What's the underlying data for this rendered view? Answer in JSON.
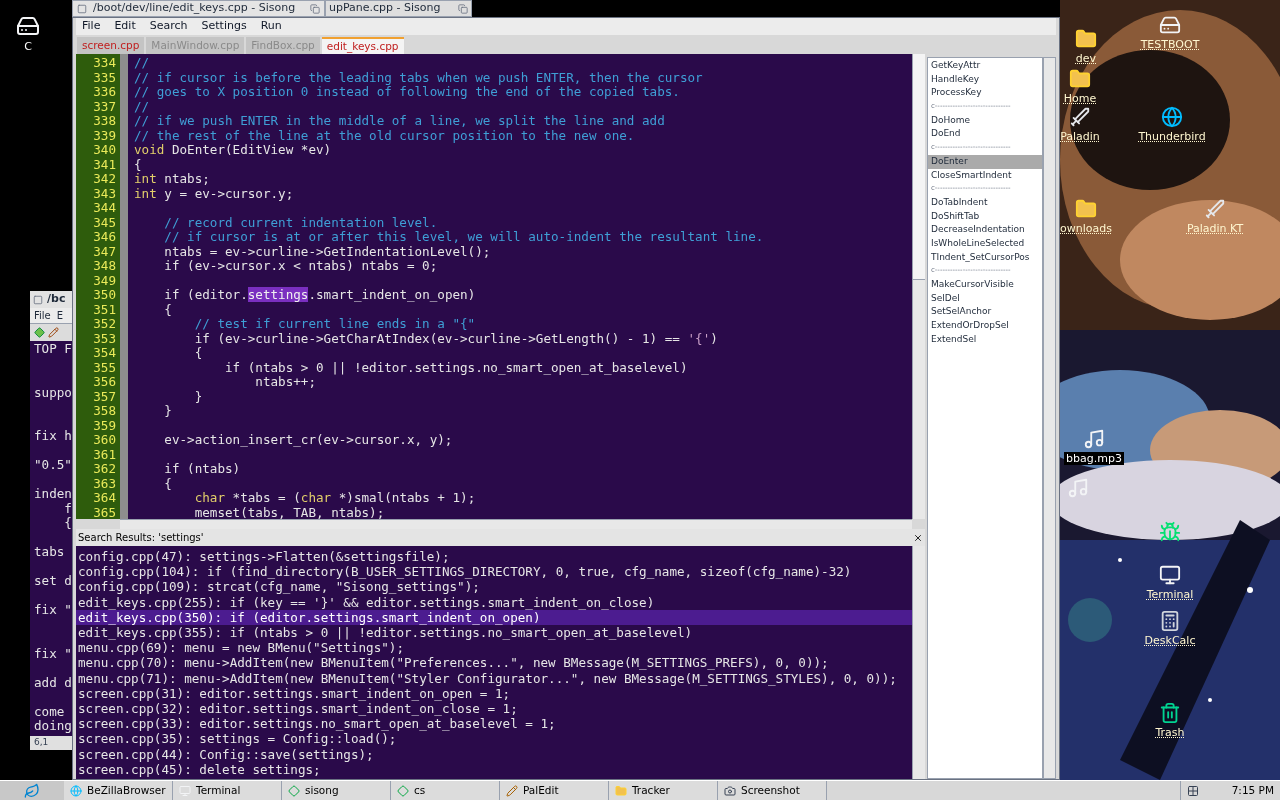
{
  "desktop": {
    "left_icon": {
      "label": "C"
    },
    "icons": [
      {
        "label": "TESTBOOT",
        "kind": "drive",
        "selected": false
      },
      {
        "label": "dev",
        "kind": "folder",
        "selected": false
      },
      {
        "label": "Home",
        "kind": "folder",
        "selected": false
      },
      {
        "label": "Paladin",
        "kind": "sword",
        "selected": false
      },
      {
        "label": "Thunderbird",
        "kind": "globe",
        "selected": false
      },
      {
        "label": "ownloads",
        "kind": "folder",
        "selected": false
      },
      {
        "label": "Paladin KT",
        "kind": "sword",
        "selected": false
      },
      {
        "label": "bbag.mp3",
        "kind": "music",
        "selected": true
      },
      {
        "kind": "music",
        "selected": false
      },
      {
        "kind": "frog",
        "selected": false
      },
      {
        "label": "Terminal",
        "kind": "terminal",
        "selected": false
      },
      {
        "label": "DeskCalc",
        "kind": "calc",
        "selected": false
      },
      {
        "label": "Trash",
        "kind": "trash",
        "selected": false
      }
    ]
  },
  "background_window": {
    "title": "/bc",
    "menu": [
      "File",
      "E"
    ],
    "lines": [
      {
        "kind": "text",
        "text": "TOP F"
      },
      {
        "kind": "blank"
      },
      {
        "kind": "blank"
      },
      {
        "kind": "text",
        "text": "suppo"
      },
      {
        "kind": "blank"
      },
      {
        "kind": "blank"
      },
      {
        "kind": "text",
        "text": "fix h"
      },
      {
        "kind": "blank"
      },
      {
        "kind": "text",
        "text": "\"0.5\""
      },
      {
        "kind": "blank"
      },
      {
        "kind": "text",
        "text": "inden"
      },
      {
        "kind": "text",
        "text": "    f"
      },
      {
        "kind": "text",
        "text": "    {"
      },
      {
        "kind": "blank"
      },
      {
        "kind": "text",
        "text": "tabs"
      },
      {
        "kind": "blank"
      },
      {
        "kind": "text",
        "text": "set d"
      },
      {
        "kind": "blank"
      },
      {
        "kind": "text",
        "text": "fix \""
      },
      {
        "kind": "blank"
      },
      {
        "kind": "blank"
      },
      {
        "kind": "text",
        "text": "fix \""
      },
      {
        "kind": "blank"
      },
      {
        "kind": "text",
        "text": "add d"
      },
      {
        "kind": "blank"
      },
      {
        "kind": "text",
        "text": "come"
      },
      {
        "kind": "text",
        "text": "doing"
      }
    ],
    "status": "6,1"
  },
  "window": {
    "title": "/boot/dev/line/edit_keys.cpp - Sisong",
    "other_title": "upPane.cpp - Sisong",
    "menu": [
      "File",
      "Edit",
      "Search",
      "Settings",
      "Run"
    ],
    "tabs": [
      {
        "label": "screen.cpp",
        "selected": false,
        "modified": true
      },
      {
        "label": "MainWindow.cpp",
        "selected": false,
        "modified": false
      },
      {
        "label": "FindBox.cpp",
        "selected": false,
        "modified": false
      },
      {
        "label": "edit_keys.cpp",
        "selected": true,
        "modified": true
      }
    ],
    "code_lines": [
      {
        "number": "334",
        "segments": [
          {
            "kind": "comment",
            "text": "//"
          }
        ]
      },
      {
        "number": "335",
        "segments": [
          {
            "kind": "comment",
            "text": "// if cursor is before the leading tabs when we push ENTER, then the cursor"
          }
        ]
      },
      {
        "number": "336",
        "segments": [
          {
            "kind": "comment",
            "text": "// goes to X position 0 instead of following the end of the copied tabs."
          }
        ]
      },
      {
        "number": "337",
        "segments": [
          {
            "kind": "comment",
            "text": "//"
          }
        ]
      },
      {
        "number": "338",
        "segments": [
          {
            "kind": "comment",
            "text": "// if we push ENTER in the middle of a line, we split the line and add"
          }
        ]
      },
      {
        "number": "339",
        "segments": [
          {
            "kind": "comment",
            "text": "// the rest of the line at the old cursor position to the new one."
          }
        ]
      },
      {
        "number": "340",
        "segments": [
          {
            "kind": "keyword",
            "text": "void"
          },
          {
            "kind": "plain",
            "text": " DoEnter(EditView *ev)"
          }
        ]
      },
      {
        "number": "341",
        "segments": [
          {
            "kind": "plain",
            "text": "{"
          }
        ]
      },
      {
        "number": "342",
        "segments": [
          {
            "kind": "keyword",
            "text": "int"
          },
          {
            "kind": "plain",
            "text": " ntabs;"
          }
        ]
      },
      {
        "number": "343",
        "segments": [
          {
            "kind": "keyword",
            "text": "int"
          },
          {
            "kind": "plain",
            "text": " y = ev->cursor.y;"
          }
        ]
      },
      {
        "number": "344"
      },
      {
        "number": "345",
        "segments": [
          {
            "kind": "comment",
            "text": "    // record current indentation level."
          }
        ]
      },
      {
        "number": "346",
        "segments": [
          {
            "kind": "comment",
            "text": "    // if cursor is at or after this level, we will auto-indent the resultant line."
          }
        ]
      },
      {
        "number": "347",
        "segments": [
          {
            "kind": "plain",
            "text": "    ntabs = ev->curline->GetIndentationLevel();"
          }
        ]
      },
      {
        "number": "348",
        "segments": [
          {
            "kind": "plain",
            "text": "    if (ev->cursor.x < ntabs) ntabs = 0;"
          }
        ]
      },
      {
        "number": "349"
      },
      {
        "number": "350",
        "segments": [
          {
            "kind": "plain",
            "text": "    if (editor."
          },
          {
            "kind": "match",
            "text": "settings"
          },
          {
            "kind": "plain",
            "text": ".smart_indent_on_open)"
          }
        ]
      },
      {
        "number": "351",
        "segments": [
          {
            "kind": "plain",
            "text": "    {"
          }
        ]
      },
      {
        "number": "352",
        "segments": [
          {
            "kind": "comment",
            "text": "        // test if current line ends in a \"{\""
          }
        ]
      },
      {
        "number": "353",
        "segments": [
          {
            "kind": "plain",
            "text": "        if (ev->curline->GetCharAtIndex(ev->curline->GetLength() - 1) == "
          },
          {
            "kind": "string",
            "text": "'{'"
          },
          {
            "kind": "plain",
            "text": ")"
          }
        ]
      },
      {
        "number": "354",
        "segments": [
          {
            "kind": "plain",
            "text": "        {"
          }
        ]
      },
      {
        "number": "355",
        "segments": [
          {
            "kind": "plain",
            "text": "            if (ntabs > 0 || !editor.settings.no_smart_open_at_baselevel)"
          }
        ]
      },
      {
        "number": "356",
        "segments": [
          {
            "kind": "plain",
            "text": "                ntabs++;"
          }
        ]
      },
      {
        "number": "357",
        "segments": [
          {
            "kind": "plain",
            "text": "        }"
          }
        ]
      },
      {
        "number": "358",
        "segments": [
          {
            "kind": "plain",
            "text": "    }"
          }
        ]
      },
      {
        "number": "359"
      },
      {
        "number": "360",
        "segments": [
          {
            "kind": "plain",
            "text": "    ev->action_insert_cr(ev->cursor.x, y);"
          }
        ]
      },
      {
        "number": "361"
      },
      {
        "number": "362",
        "segments": [
          {
            "kind": "plain",
            "text": "    if (ntabs)"
          }
        ]
      },
      {
        "number": "363",
        "segments": [
          {
            "kind": "plain",
            "text": "    {"
          }
        ]
      },
      {
        "number": "364",
        "segments": [
          {
            "kind": "keyword",
            "text": "        char"
          },
          {
            "kind": "plain",
            "text": " *tabs = ("
          },
          {
            "kind": "keyword",
            "text": "char"
          },
          {
            "kind": "plain",
            "text": " *)smal(ntabs + 1);"
          }
        ]
      },
      {
        "number": "365",
        "segments": [
          {
            "kind": "plain",
            "text": "        memset(tabs, TAB, ntabs);"
          }
        ]
      }
    ],
    "functions": [
      {
        "kind": "function",
        "label": "GetKeyAttr",
        "selected": false
      },
      {
        "kind": "function",
        "label": "HandleKey",
        "selected": false
      },
      {
        "kind": "function",
        "label": "ProcessKey",
        "selected": false
      },
      {
        "kind": "separator",
        "label": "c------------------------------"
      },
      {
        "kind": "function",
        "label": "DoHome",
        "selected": false
      },
      {
        "kind": "function",
        "label": "DoEnd",
        "selected": false
      },
      {
        "kind": "separator",
        "label": "c------------------------------"
      },
      {
        "kind": "function",
        "label": "DoEnter",
        "selected": true
      },
      {
        "kind": "function",
        "label": "CloseSmartIndent",
        "selected": false
      },
      {
        "kind": "separator",
        "label": "c------------------------------"
      },
      {
        "kind": "function",
        "label": "DoTabIndent",
        "selected": false
      },
      {
        "kind": "function",
        "label": "DoShiftTab",
        "selected": false
      },
      {
        "kind": "function",
        "label": "DecreaseIndentation",
        "selected": false
      },
      {
        "kind": "function",
        "label": "IsWholeLineSelected",
        "selected": false
      },
      {
        "kind": "function",
        "label": "TIndent_SetCursorPos",
        "selected": false
      },
      {
        "kind": "separator",
        "label": "c------------------------------"
      },
      {
        "kind": "function",
        "label": "MakeCursorVisible",
        "selected": false
      },
      {
        "kind": "function",
        "label": "SelDel",
        "selected": false
      },
      {
        "kind": "function",
        "label": "SetSelAnchor",
        "selected": false
      },
      {
        "kind": "function",
        "label": "ExtendOrDropSel",
        "selected": false
      },
      {
        "kind": "function",
        "label": "ExtendSel",
        "selected": false
      }
    ],
    "search_results": {
      "title": "Search Results: 'settings'",
      "lines": [
        {
          "text": "config.cpp(47): settings->Flatten(&settingsfile);",
          "selected": false
        },
        {
          "text": "config.cpp(104): if (find_directory(B_USER_SETTINGS_DIRECTORY, 0, true, cfg_name, sizeof(cfg_name)-32)",
          "selected": false
        },
        {
          "text": "config.cpp(109): strcat(cfg_name, \"Sisong_settings\");",
          "selected": false
        },
        {
          "text": "edit_keys.cpp(255): if (key == '}' && editor.settings.smart_indent_on_close)",
          "selected": false
        },
        {
          "text": "edit_keys.cpp(350): if (editor.settings.smart_indent_on_open)",
          "selected": true
        },
        {
          "text": "edit_keys.cpp(355): if (ntabs > 0 || !editor.settings.no_smart_open_at_baselevel)",
          "selected": false
        },
        {
          "text": "menu.cpp(69): menu = new BMenu(\"Settings\");",
          "selected": false
        },
        {
          "text": "menu.cpp(70): menu->AddItem(new BMenuItem(\"Preferences...\", new BMessage(M_SETTINGS_PREFS), 0, 0));",
          "selected": false
        },
        {
          "text": "menu.cpp(71): menu->AddItem(new BMenuItem(\"Styler Configurator...\", new BMessage(M_SETTINGS_STYLES), 0, 0));",
          "selected": false
        },
        {
          "text": "screen.cpp(31): editor.settings.smart_indent_on_open = 1;",
          "selected": false
        },
        {
          "text": "screen.cpp(32): editor.settings.smart_indent_on_close = 1;",
          "selected": false
        },
        {
          "text": "screen.cpp(33): editor.settings.no_smart_open_at_baselevel = 1;",
          "selected": false
        },
        {
          "text": "screen.cpp(35): settings = Config::load();",
          "selected": false
        },
        {
          "text": "screen.cpp(44): Config::save(settings);",
          "selected": false
        },
        {
          "text": "screen.cpp(45): delete settings;",
          "selected": false
        }
      ]
    }
  },
  "taskbar": {
    "items": [
      {
        "label": "BeZillaBrowser",
        "kind": "globe"
      },
      {
        "label": "Terminal",
        "kind": "terminal"
      },
      {
        "label": "sisong",
        "kind": "diamond"
      },
      {
        "label": "cs",
        "kind": "diamond"
      },
      {
        "label": "PalEdit",
        "kind": "pencil"
      },
      {
        "label": "Tracker",
        "kind": "folder"
      },
      {
        "label": "Screenshot",
        "kind": "camera"
      }
    ],
    "clock": "7:15 PM"
  }
}
